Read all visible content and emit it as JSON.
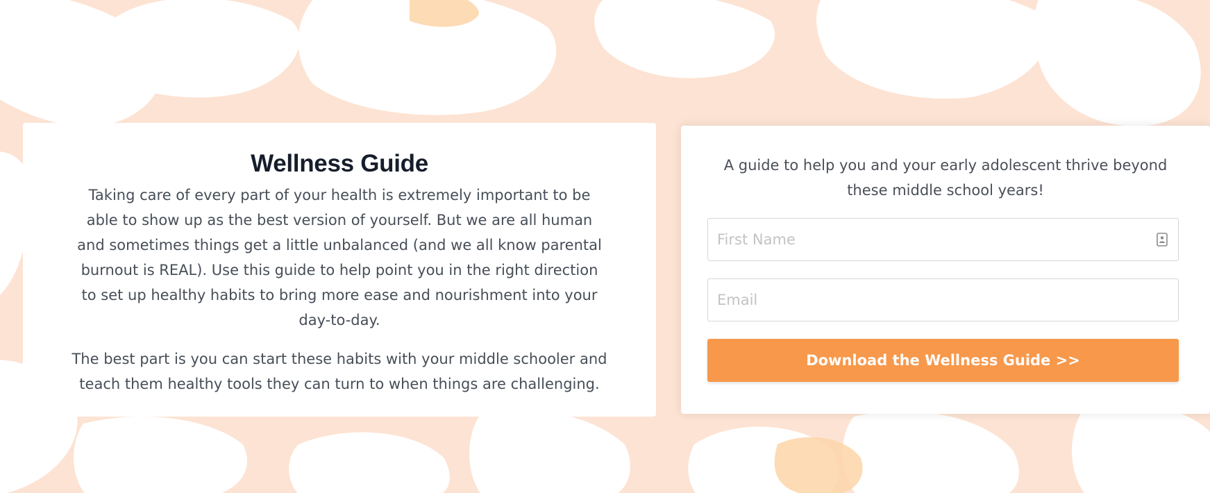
{
  "colors": {
    "background": "#fde3d3",
    "accent_orange": "#f7984b",
    "heading": "#161d2b",
    "body_text": "#474e57"
  },
  "info": {
    "title": "Wellness Guide",
    "paragraph1": "Taking care of every part of your health is extremely important to be able to show up as the best version of yourself. But we are all human and sometimes things get a little unbalanced (and we all know parental burnout is REAL). Use this guide to help point you in the right direction to set up healthy habits to bring more ease and nourishment into your day-to-day.",
    "paragraph2": "The best part is you can start these habits with your middle schooler and teach them healthy tools they can turn to when things are challenging."
  },
  "form": {
    "tagline": "A guide to help you and your early adolescent thrive beyond these middle school years!",
    "first_name": {
      "placeholder": "First Name",
      "value": "",
      "icon": "contact-card-icon"
    },
    "email": {
      "placeholder": "Email",
      "value": ""
    },
    "submit_label": "Download the Wellness Guide >>"
  }
}
